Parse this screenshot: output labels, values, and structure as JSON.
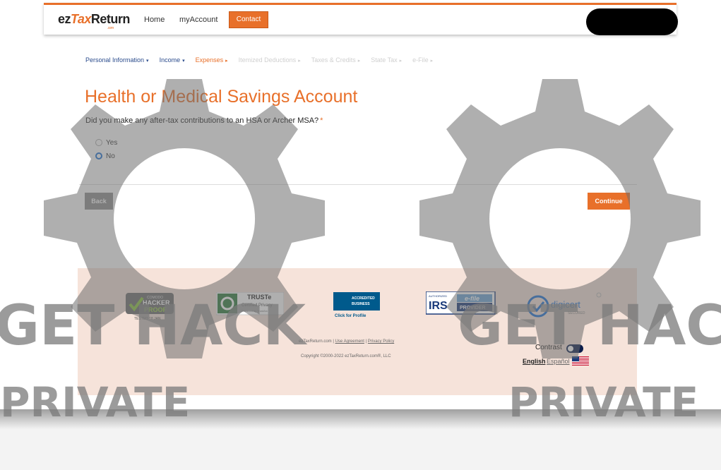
{
  "header": {
    "logo_ez": "ez",
    "logo_tax": "Tax",
    "logo_return": "Return",
    "logo_com": ".com",
    "nav": [
      "Home",
      "myAccount"
    ],
    "contact_label": "Contact"
  },
  "steps": [
    {
      "label": "Personal Information",
      "state": "done",
      "arrow": "▾"
    },
    {
      "label": "Income",
      "state": "done",
      "arrow": "▾"
    },
    {
      "label": "Expenses",
      "state": "current",
      "arrow": "▸"
    },
    {
      "label": "Itemized Deductions",
      "state": "future",
      "arrow": "▸"
    },
    {
      "label": "Taxes & Credits",
      "state": "future",
      "arrow": "▸"
    },
    {
      "label": "State Tax",
      "state": "future",
      "arrow": "▸"
    },
    {
      "label": "e-File",
      "state": "future",
      "arrow": "▸"
    }
  ],
  "main": {
    "title": "Health or Medical Savings Account",
    "question": "Did you make any after-tax contributions to an HSA or Archer MSA?",
    "required_mark": "*",
    "options": [
      {
        "label": "Yes",
        "checked": false
      },
      {
        "label": "No",
        "checked": true
      }
    ],
    "back_label": "Back",
    "continue_label": "Continue"
  },
  "footer": {
    "badges": {
      "hacker_top": "COMODO",
      "hacker_main1": "HACKER",
      "hacker_main2": "PROOF",
      "hacker_tested": "TESTED 18 JAN",
      "truste_title": "TRUSTe",
      "truste_sub": "Certified Privacy",
      "truste_powered": "Powered by TrustArc",
      "bbb_line1": "ACCREDITED",
      "bbb_line2": "BUSINESS",
      "bbb_click": "Click for Profile",
      "irs_auth": "AUTHORIZED",
      "irs_main": "IRS",
      "irs_efile": "e-file",
      "irs_provider": "PROVIDER",
      "digicert_name": "digicert",
      "digicert_secured": "SECURED"
    },
    "link_site": "ezTaxReturn.com",
    "link_sep": " | ",
    "link_use": "Use Agreement",
    "link_privacy": "Privacy Policy",
    "copyright": "Copyright ©2000-2022 ezTaxReturn.com®, LLC",
    "contrast_label": "Contrast",
    "lang_en": "English",
    "lang_es": "Español"
  },
  "watermark": {
    "line1": "GET HACK",
    "line2": "PRIVATE"
  },
  "colors": {
    "accent": "#e8702a",
    "nav_blue": "#2a4b8c",
    "radio_blue": "#1a6fd6",
    "footer_bg": "#f6e3da"
  }
}
